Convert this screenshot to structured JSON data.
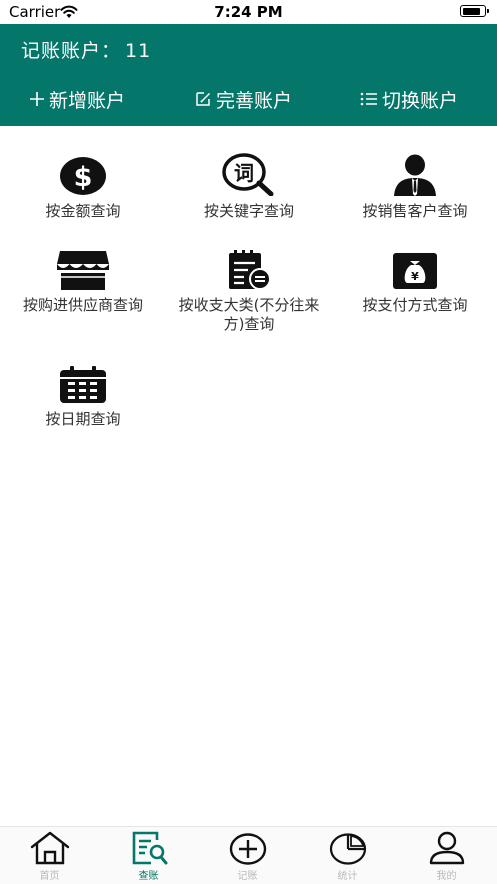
{
  "status_bar": {
    "carrier": "Carrier",
    "time": "7:24 PM",
    "battery_level": 0.85
  },
  "header": {
    "title": "记账账户：",
    "count": "11",
    "actions": [
      {
        "label": "新增账户",
        "icon": "plus-icon"
      },
      {
        "label": "完善账户",
        "icon": "edit-icon"
      },
      {
        "label": "切换账户",
        "icon": "list-icon"
      }
    ]
  },
  "grid": {
    "items": [
      {
        "label": "按金额查询",
        "icon": "dollar-icon"
      },
      {
        "label": "按关键字查询",
        "icon": "keyword-search-icon"
      },
      {
        "label": "按销售客户查询",
        "icon": "customer-icon"
      },
      {
        "label": "按购进供应商查询",
        "icon": "store-icon"
      },
      {
        "label": "按收支大类(不分往来方)查询",
        "icon": "category-icon"
      },
      {
        "label": "按支付方式查询",
        "icon": "yen-bag-icon"
      },
      {
        "label": "按日期查询",
        "icon": "calendar-icon"
      }
    ]
  },
  "tab_bar": {
    "active": "查账",
    "active_color": "#05766a",
    "tabs": [
      {
        "label": "首页",
        "icon": "home-icon"
      },
      {
        "label": "查账",
        "icon": "ledger-search-icon"
      },
      {
        "label": "记账",
        "icon": "add-circle-icon"
      },
      {
        "label": "统计",
        "icon": "pie-chart-icon"
      },
      {
        "label": "我的",
        "icon": "user-icon"
      }
    ]
  },
  "colors": {
    "primary": "#05766a",
    "inactive": "#b8b8b8",
    "icon": "#111111"
  }
}
